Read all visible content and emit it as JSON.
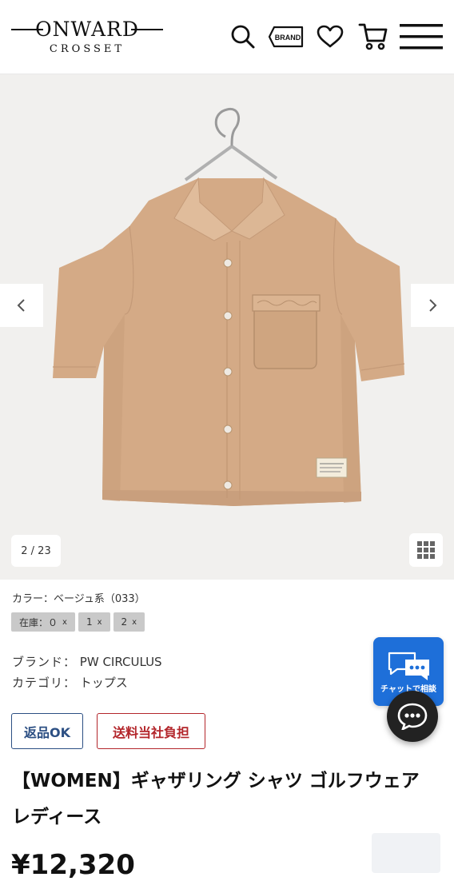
{
  "header": {
    "logo_main": "ONWARD",
    "logo_sub": "CROSSET",
    "brand_label": "BRAND",
    "icons": [
      "search-icon",
      "brand-icon",
      "heart-icon",
      "cart-icon",
      "menu-icon"
    ]
  },
  "gallery": {
    "counter": "2 / 23",
    "colors": {
      "background": "#f1f0ee",
      "shirt": "#d4aa86"
    }
  },
  "product": {
    "color_label": "カラー：ベージュ系（033）",
    "stock": [
      {
        "label": "在庫：０",
        "mark": "x"
      },
      {
        "label": "1",
        "mark": "x"
      },
      {
        "label": "2",
        "mark": "x"
      }
    ],
    "brand_key": "ブランド：",
    "brand_value": "PW CIRCULUS",
    "category_key": "カテゴリ：",
    "category_value": "トップス",
    "badges": {
      "returns": "返品OK",
      "shipping": "送料当社負担"
    },
    "title": "【WOMEN】ギャザリング シャツ ゴルフウェア レディース",
    "price": "¥12,320"
  },
  "chat": {
    "label": "チャットで相談"
  },
  "theme": {
    "accent_blue": "#1e6fd9",
    "badge_blue": "#2c4f83",
    "badge_red": "#b3262b"
  }
}
